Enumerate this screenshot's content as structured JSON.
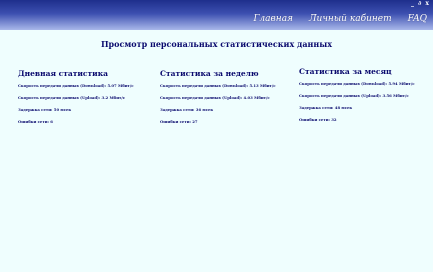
{
  "header": {
    "corner": "_ ∂ x",
    "nav": [
      {
        "label": "Главная"
      },
      {
        "label": "Личный кабинет"
      },
      {
        "label": "FAQ"
      }
    ]
  },
  "page": {
    "title": "Просмотр персональных статистических данных"
  },
  "columns": [
    {
      "title": "Дневная статистика",
      "rows": [
        {
          "label": "Скорость передачи данных (Download):",
          "value": "5.07 Мбит/с"
        },
        {
          "label": "Скорость передачи данных (Upload):",
          "value": "3.2 Мбит/с"
        },
        {
          "label": "Задержка сети:",
          "value": "50 мсек"
        },
        {
          "label": "Ошибки сети:",
          "value": "6"
        }
      ]
    },
    {
      "title": "Статистика за неделю",
      "rows": [
        {
          "label": "Скорость передачи данных (Download):",
          "value": "5.13 Мбит/с"
        },
        {
          "label": "Скорость передачи данных (Upload):",
          "value": "4.03 Мбит/с"
        },
        {
          "label": "Задержка сети:",
          "value": "36 мсек"
        },
        {
          "label": "Ошибки сети:",
          "value": "27"
        }
      ]
    },
    {
      "title": "Статистика за месяц",
      "rows": [
        {
          "label": "Скорость передачи данных (Download):",
          "value": "5.94 Мбит/с"
        },
        {
          "label": "Скорость передачи данных (Upload):",
          "value": "3.56 Мбит/с"
        },
        {
          "label": "Задержка сети:",
          "value": "48 мсек"
        },
        {
          "label": "Ошибки сети:",
          "value": "32"
        }
      ]
    }
  ]
}
